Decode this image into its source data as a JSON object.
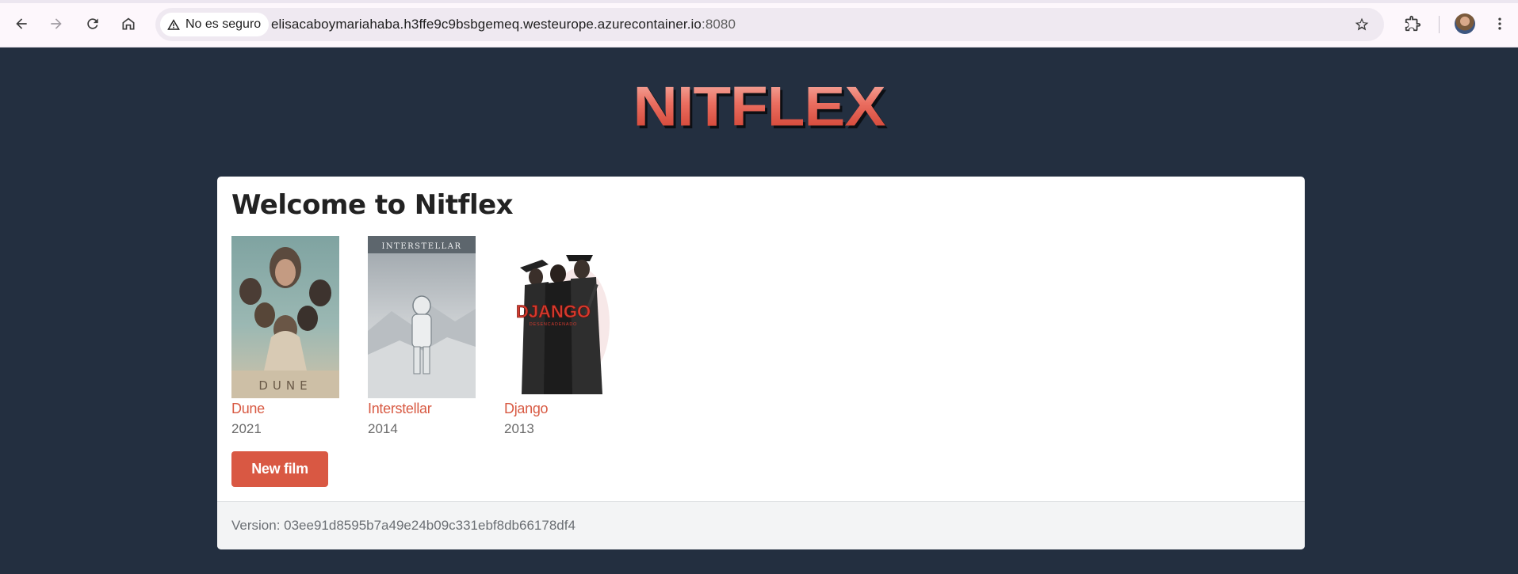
{
  "browser": {
    "security_label": "No es seguro",
    "url_host": "elisacaboymariahaba.h3ffe9c9bsbgemeq.westeurope.azurecontainer.io",
    "url_port": ":8080"
  },
  "site": {
    "logo_text": "NITFLEX",
    "page_title": "Welcome to Nitflex",
    "new_film_label": "New film",
    "version_text": "Version: 03ee91d8595b7a49e24b09c331ebf8db66178df4"
  },
  "films": [
    {
      "title": "Dune",
      "year": "2021",
      "poster_text": "DUNE"
    },
    {
      "title": "Interstellar",
      "year": "2014",
      "poster_text": "INTERSTELLAR"
    },
    {
      "title": "Django",
      "year": "2013",
      "poster_text": "DJANGO",
      "poster_subtext": "DESENCADENADO"
    }
  ],
  "colors": {
    "page_background": "#232f40",
    "accent": "#d95843",
    "film_link": "#d85a43"
  }
}
